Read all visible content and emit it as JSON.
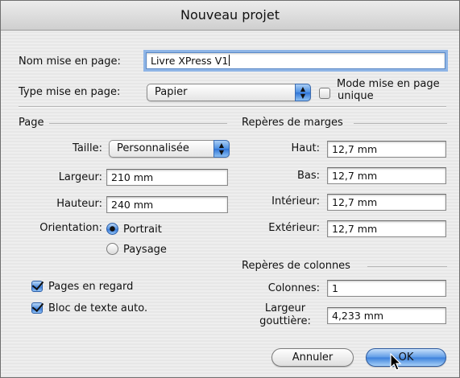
{
  "window": {
    "title": "Nouveau projet"
  },
  "layout": {
    "name_label": "Nom mise en page:",
    "name_value": "Livre XPress V1",
    "type_label": "Type mise en page:",
    "type_value": "Papier",
    "single_mode_label_line1": "Mode mise en page",
    "single_mode_label_line2": "unique",
    "single_mode_checked": false
  },
  "page": {
    "section_title": "Page",
    "size_label": "Taille:",
    "size_value": "Personnalisée",
    "width_label": "Largeur:",
    "width_value": "210 mm",
    "height_label": "Hauteur:",
    "height_value": "240 mm",
    "orientation_label": "Orientation:",
    "orientation_options": [
      "Portrait",
      "Paysage"
    ],
    "orientation_selected": "Portrait",
    "facing_pages_label": "Pages en regard",
    "facing_pages_checked": true,
    "auto_text_box_label": "Bloc de texte auto.",
    "auto_text_box_checked": true
  },
  "margins": {
    "section_title": "Repères de marges",
    "top_label": "Haut:",
    "top_value": "12,7 mm",
    "bottom_label": "Bas:",
    "bottom_value": "12,7 mm",
    "inside_label": "Intérieur:",
    "inside_value": "12,7 mm",
    "outside_label": "Extérieur:",
    "outside_value": "12,7 mm"
  },
  "columns": {
    "section_title": "Repères de colonnes",
    "columns_label": "Colonnes:",
    "columns_value": "1",
    "gutter_label_line1": "Largeur",
    "gutter_label_line2": "gouttière:",
    "gutter_value": "4,233 mm"
  },
  "buttons": {
    "cancel": "Annuler",
    "ok": "OK"
  },
  "colors": {
    "accent": "#3b80dc",
    "focus_ring": "#8fb5e6"
  },
  "icons": {
    "popup_arrows": "up-down-arrows-icon",
    "cursor": "mouse-pointer-icon"
  }
}
